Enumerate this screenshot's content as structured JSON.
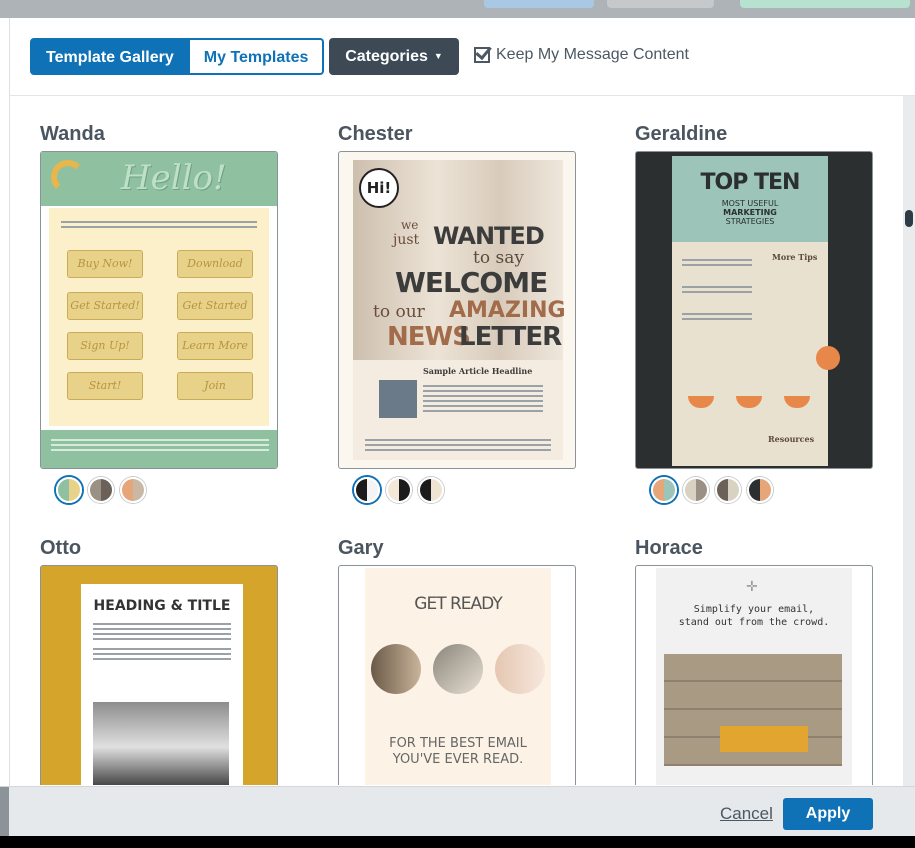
{
  "toolbar": {
    "template_gallery": "Template Gallery",
    "my_templates": "My Templates",
    "categories": "Categories",
    "keep_content": "Keep My Message Content"
  },
  "templates": [
    {
      "name": "Wanda",
      "swatches": [
        [
          "#8fc0a0",
          "#e8d28a"
        ],
        [
          "#9a9084",
          "#6b6159"
        ],
        [
          "#e7a57a",
          "#c9b8a4"
        ]
      ],
      "selected": 0
    },
    {
      "name": "Chester",
      "swatches": [
        [
          "#1b1b1b",
          "#f4f4f4"
        ],
        [
          "#f3e8d8",
          "#1b1b1b"
        ],
        [
          "#1b1b1b",
          "#efe4d2"
        ]
      ],
      "selected": 0
    },
    {
      "name": "Geraldine",
      "swatches": [
        [
          "#e7a57a",
          "#9cc4b8"
        ],
        [
          "#d9d2c2",
          "#9a9084"
        ],
        [
          "#6b6159",
          "#d9d2c2"
        ],
        [
          "#2b2f30",
          "#e7a57a"
        ]
      ],
      "selected": 0
    },
    {
      "name": "Otto",
      "swatches": [],
      "selected": null
    },
    {
      "name": "Gary",
      "swatches": [],
      "selected": null
    },
    {
      "name": "Horace",
      "swatches": [],
      "selected": null
    }
  ],
  "thumbs": {
    "wanda": {
      "hello": "Hello!",
      "buttons": [
        "Buy Now!",
        "Download",
        "Get Started!",
        "Get Started",
        "Sign Up!",
        "Learn More",
        "Start!",
        "Join"
      ]
    },
    "chester": {
      "hi": "Hi!",
      "we": "we",
      "just": "just",
      "wanted": "WANTED",
      "to_say": "to say",
      "welcome": "WELCOME",
      "to_our": "to our",
      "amazing": "AMAZING",
      "news": "NEWS",
      "letter": "LETTER",
      "headline": "Sample Article Headline"
    },
    "geraldine": {
      "top_ten": "TOP TEN",
      "sub1": "MOST USEFUL",
      "sub2": "MARKETING",
      "sub3": "STRATEGIES",
      "more_tips": "More Tips",
      "resources": "Resources"
    },
    "otto": {
      "heading": "HEADING & TITLE"
    },
    "gary": {
      "get_ready": "GET READY",
      "tag1": "FOR THE BEST EMAIL",
      "tag2": "YOU'VE EVER READ."
    },
    "horace": {
      "line1": "Simplify your email,",
      "line2": "stand out from the crowd."
    }
  },
  "footer": {
    "cancel": "Cancel",
    "apply": "Apply"
  },
  "colors": {
    "primary": "#0f72b7",
    "dark_button": "#3d4a55",
    "wanda_green": "#8fc0a0",
    "gold": "#d4a52a"
  }
}
